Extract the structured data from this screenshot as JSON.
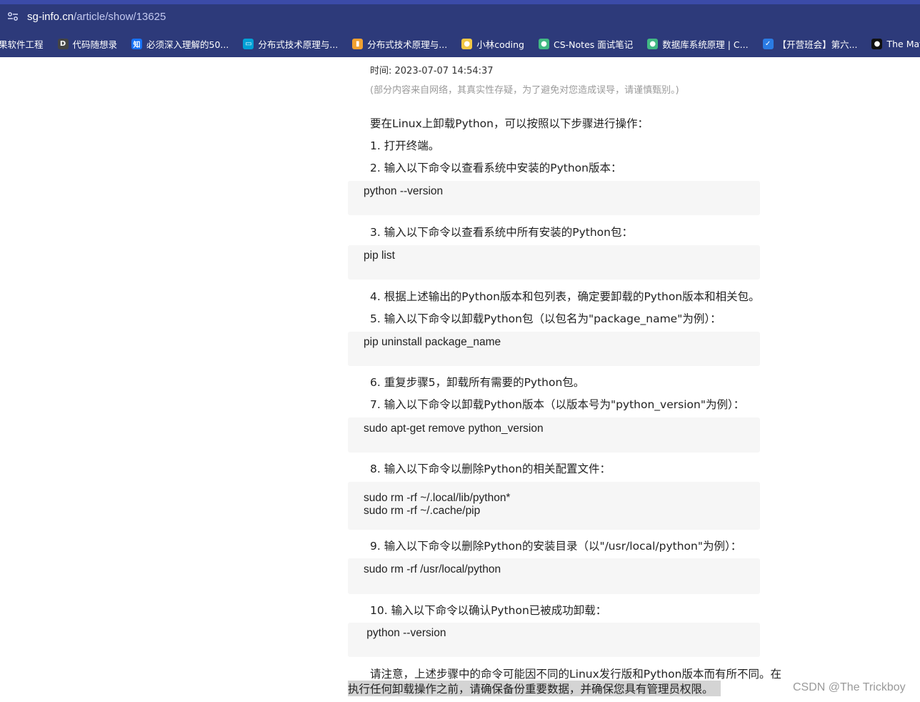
{
  "browser": {
    "url_host": "sg-info.cn",
    "url_path": "/article/show/13625",
    "bookmarks": [
      {
        "label": "果软件工程",
        "icon": "none",
        "color": ""
      },
      {
        "label": "代码随想录",
        "icon": "book-icon",
        "color": "#444444"
      },
      {
        "label": "必须深入理解的50...",
        "icon": "zhihu-icon",
        "color": "#1772f6"
      },
      {
        "label": "分布式技术原理与...",
        "icon": "bilibili-icon",
        "color": "#00a1d6"
      },
      {
        "label": "分布式技术原理与...",
        "icon": "geektime-icon",
        "color": "#f0a030"
      },
      {
        "label": "小林coding",
        "icon": "xiaolin-icon",
        "color": "#f2c744"
      },
      {
        "label": "CS-Notes 面试笔记",
        "icon": "cs-notes-icon",
        "color": "#41b883"
      },
      {
        "label": "数据库系统原理 | C...",
        "icon": "db-icon",
        "color": "#41b883"
      },
      {
        "label": "【开营班会】第六...",
        "icon": "ka-icon",
        "color": "#2a7be4"
      },
      {
        "label": "The Matrix Team",
        "icon": "github-icon",
        "color": "#111111"
      }
    ]
  },
  "article": {
    "time": "时间: 2023-07-07 14:54:37",
    "note": "(部分内容来自网络，其真实性存疑，为了避免对您造成误导，请谨慎甄别。)",
    "intro": "要在Linux上卸载Python，可以按照以下步骤进行操作：",
    "steps": [
      "1. 打开终端。",
      "2. 输入以下命令以查看系统中安装的Python版本：",
      "3. 输入以下命令以查看系统中所有安装的Python包：",
      "4. 根据上述输出的Python版本和包列表，确定要卸载的Python版本和相关包。",
      "5. 输入以下命令以卸载Python包（以包名为\"package_name\"为例）：",
      "6. 重复步骤5，卸载所有需要的Python包。",
      "7. 输入以下命令以卸载Python版本（以版本号为\"python_version\"为例）：",
      "8. 输入以下命令以删除Python的相关配置文件：",
      "9. 输入以下命令以删除Python的安装目录（以\"/usr/local/python\"为例）：",
      "10. 输入以下命令以确认Python已被成功卸载："
    ],
    "codes": [
      [
        "python --version"
      ],
      [
        "pip list"
      ],
      [
        "pip uninstall package_name"
      ],
      [
        "sudo apt-get remove python_version"
      ],
      [
        "sudo rm -rf ~/.local/lib/python*",
        "sudo rm -rf ~/.cache/pip"
      ],
      [
        "sudo rm -rf /usr/local/python"
      ],
      [
        " python --version"
      ]
    ],
    "closing_line1": "请注意，上述步骤中的命令可能因不同的Linux发行版和Python版本而有所不同。在",
    "closing_line2": "执行任何卸载操作之前，请确保备份重要数据，并确保您具有管理员权限。"
  },
  "watermark": "CSDN @The Trickboy"
}
